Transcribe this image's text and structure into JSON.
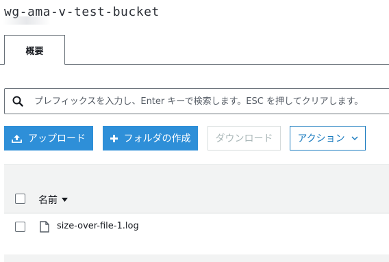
{
  "bucket": {
    "name": "wg-ama-v-test-bucket"
  },
  "tabs": [
    {
      "label": "概要",
      "active": true
    }
  ],
  "search": {
    "placeholder": "プレフィックスを入力し、Enter キーで検索します。ESC を押してクリアします。",
    "value": ""
  },
  "toolbar": {
    "upload_label": "アップロード",
    "create_folder_label": "フォルダの作成",
    "download_label": "ダウンロード",
    "actions_label": "アクション"
  },
  "table": {
    "columns": [
      {
        "label": "名前",
        "sort": "descending"
      }
    ],
    "rows": [
      {
        "name": "size-over-file-1.log",
        "type": "file",
        "selected": false
      }
    ]
  },
  "colors": {
    "primary": "#2e8fd8",
    "link": "#1a7bbf",
    "disabled": "#aab7b8",
    "border": "#687078",
    "table_band": "#f2f3f3"
  }
}
